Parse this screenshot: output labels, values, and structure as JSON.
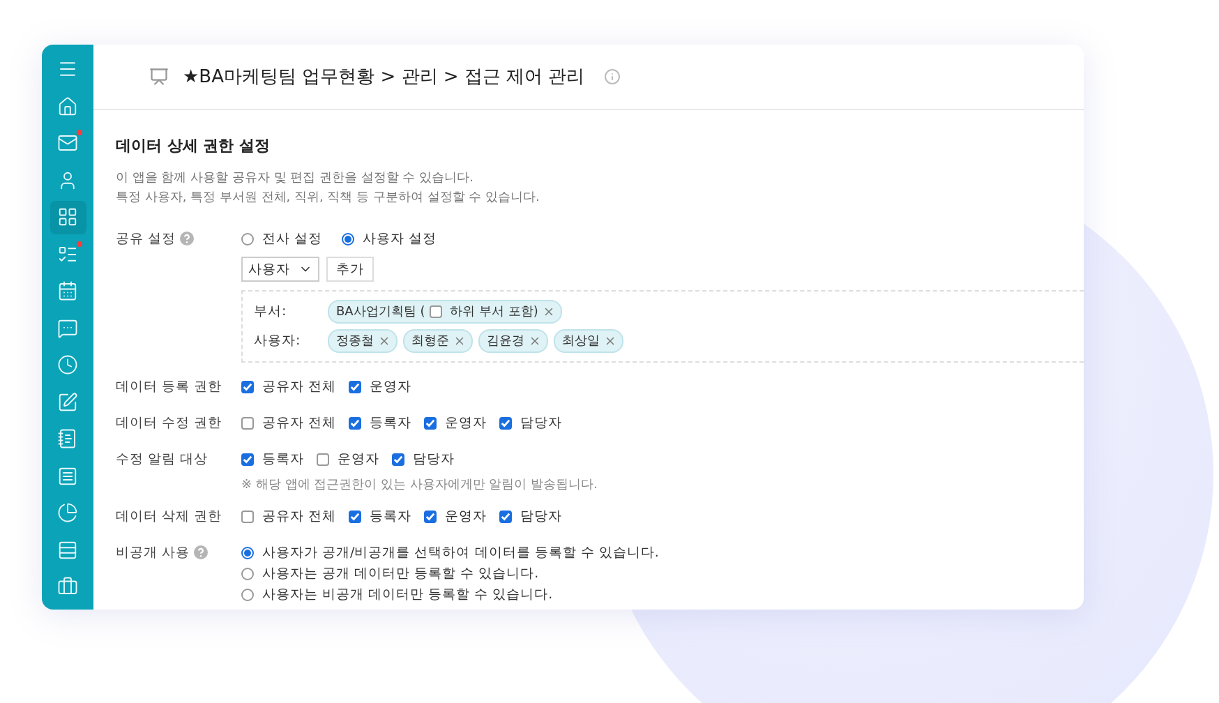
{
  "sidebar": {
    "items": [
      {
        "selected": false,
        "badge": false
      },
      {
        "selected": false,
        "badge": false
      },
      {
        "selected": false,
        "badge": true
      },
      {
        "selected": false,
        "badge": false
      },
      {
        "selected": true,
        "badge": false
      },
      {
        "selected": false,
        "badge": true
      },
      {
        "selected": false,
        "badge": false
      },
      {
        "selected": false,
        "badge": false
      },
      {
        "selected": false,
        "badge": false
      },
      {
        "selected": false,
        "badge": false
      },
      {
        "selected": false,
        "badge": false
      },
      {
        "selected": false,
        "badge": false
      },
      {
        "selected": false,
        "badge": false
      },
      {
        "selected": false,
        "badge": false
      },
      {
        "selected": false,
        "badge": false
      }
    ]
  },
  "header": {
    "title": "★BA마케팅팀 업무현황 > 관리 > 접근 제어 관리"
  },
  "section": {
    "heading": "데이터 상세 권한 설정",
    "description": [
      "이 앱을 함께 사용할 공유자 및 편집 권한을 설정할 수 있습니다.",
      "특정 사용자, 특정 부서원 전체, 직위, 직책 등 구분하여 설정할 수 있습니다."
    ]
  },
  "share": {
    "label": "공유 설정",
    "help": true,
    "options": [
      {
        "label": "전사 설정",
        "selected": false
      },
      {
        "label": "사용자 설정",
        "selected": true
      }
    ],
    "select": {
      "value": "사용자"
    },
    "add_button": "추가",
    "groups": [
      {
        "label": "부서:",
        "tags": [
          {
            "text": "BA사업기획팀 (",
            "sub_checkbox": {
              "label": "하위 부서 포함)",
              "checked": false
            }
          }
        ]
      },
      {
        "label": "사용자:",
        "tags": [
          {
            "text": "정종철"
          },
          {
            "text": "최형준"
          },
          {
            "text": "김윤경"
          },
          {
            "text": "최상일"
          }
        ]
      }
    ]
  },
  "permissions": [
    {
      "label": "데이터 등록 권한",
      "kind": "checkboxes",
      "options": [
        {
          "label": "공유자 전체",
          "checked": true
        },
        {
          "label": "운영자",
          "checked": true
        }
      ]
    },
    {
      "label": "데이터 수정 권한",
      "kind": "checkboxes",
      "options": [
        {
          "label": "공유자 전체",
          "checked": false
        },
        {
          "label": "등록자",
          "checked": true
        },
        {
          "label": "운영자",
          "checked": true
        },
        {
          "label": "담당자",
          "checked": true
        }
      ]
    },
    {
      "label": "수정 알림 대상",
      "kind": "checkboxes",
      "options": [
        {
          "label": "등록자",
          "checked": true
        },
        {
          "label": "운영자",
          "checked": false
        },
        {
          "label": "담당자",
          "checked": true
        }
      ],
      "note": "※ 해당 앱에 접근권한이 있는 사용자에게만 알림이 발송됩니다."
    },
    {
      "label": "데이터 삭제 권한",
      "kind": "checkboxes",
      "options": [
        {
          "label": "공유자 전체",
          "checked": false
        },
        {
          "label": "등록자",
          "checked": true
        },
        {
          "label": "운영자",
          "checked": true
        },
        {
          "label": "담당자",
          "checked": true
        }
      ]
    },
    {
      "label": "비공개 사용",
      "kind": "radios",
      "help": true,
      "options": [
        {
          "label": "사용자가 공개/비공개를 선택하여 데이터를 등록할 수 있습니다.",
          "selected": true
        },
        {
          "label": "사용자는 공개 데이터만 등록할 수 있습니다.",
          "selected": false
        },
        {
          "label": "사용자는 비공개 데이터만 등록할 수 있습니다.",
          "selected": false
        }
      ]
    }
  ]
}
